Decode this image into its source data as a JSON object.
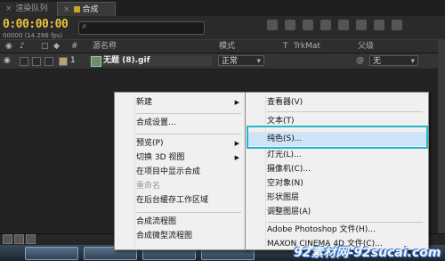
{
  "tabs": [
    {
      "label": "渲染队列"
    },
    {
      "label": "合成"
    }
  ],
  "toolbar": {
    "timecode": "0:00:00:00",
    "fps": "00000 (14.286 fps)",
    "search_placeholder": ""
  },
  "columns": {
    "num": "#",
    "source_name": "源名称",
    "mode": "模式",
    "t": "T",
    "trkmat": "TrkMat",
    "parent": "父级"
  },
  "layer": {
    "number": "1",
    "name": "无题 (8).gif",
    "mode": "正常",
    "parent": "无"
  },
  "context_menu": {
    "items": [
      {
        "label": "新建",
        "submenu": true
      },
      {
        "label": "合成设置..."
      },
      {
        "label": "预览(P)",
        "submenu": true
      },
      {
        "label": "切换 3D 视图",
        "submenu": true
      },
      {
        "label": "在项目中显示合成"
      },
      {
        "label": "重命名",
        "disabled": true
      },
      {
        "label": "在后台缓存工作区域"
      },
      {
        "label": "合成流程图"
      },
      {
        "label": "合成微型流程图"
      }
    ]
  },
  "submenu": {
    "items": [
      {
        "label": "查看器(V)"
      },
      {
        "label": "文本(T)"
      },
      {
        "label": "纯色(S)...",
        "highlighted": true
      },
      {
        "label": "灯光(L)..."
      },
      {
        "label": "摄像机(C)..."
      },
      {
        "label": "空对象(N)"
      },
      {
        "label": "形状图层"
      },
      {
        "label": "调整图层(A)"
      },
      {
        "label": "Adobe Photoshop 文件(H)..."
      },
      {
        "label": "MAXON CINEMA 4D 文件(C)..."
      }
    ]
  },
  "watermark": "92素材网-92sucai.com",
  "colors": {
    "timecode": "#e8c43a",
    "highlight_box": "#28b7c9",
    "menu_background": "#f0f0f0"
  }
}
